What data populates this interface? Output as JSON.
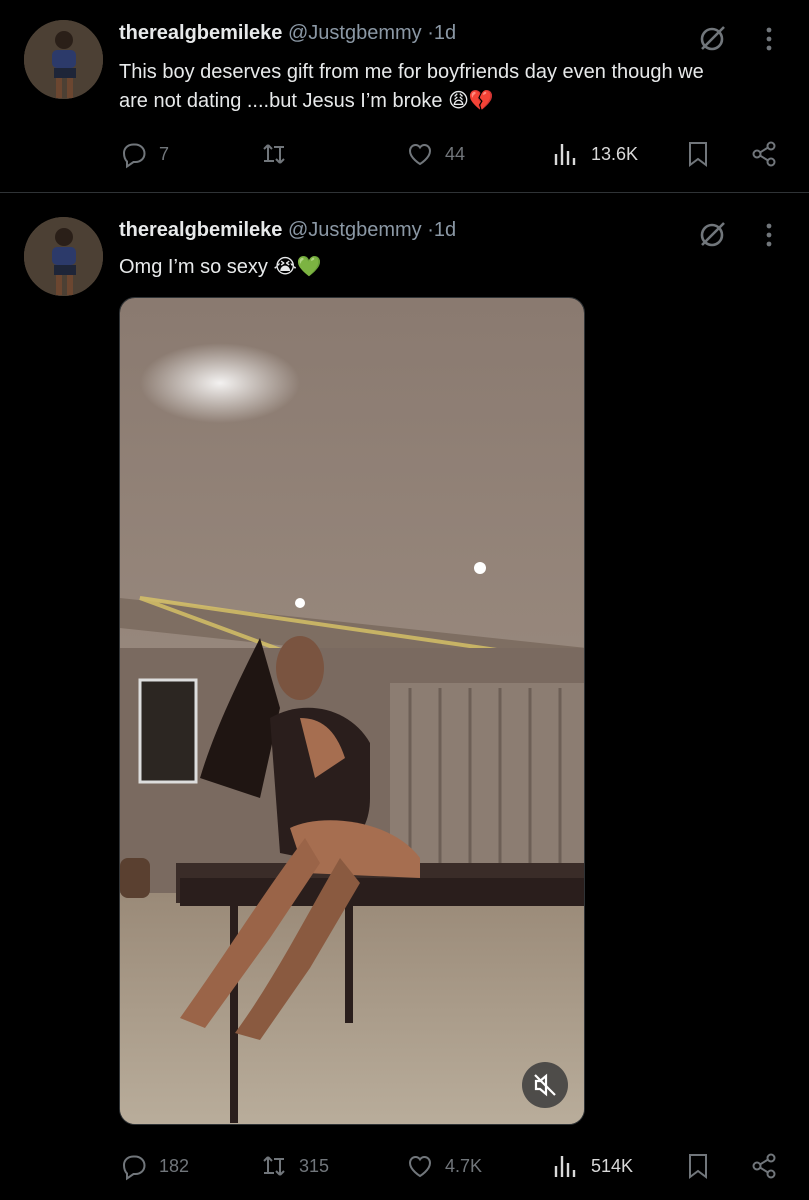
{
  "tweets": [
    {
      "name": "therealgbemileke",
      "handle": "@Justgbemmy",
      "dot": "·",
      "time": "1d",
      "line1": "This boy deserves gift from me for boyfriends day even though we",
      "line2": "are not dating ....but Jesus I’m broke 😩💔",
      "replies": "7",
      "reposts": "",
      "likes": "44",
      "views": "13.6K"
    },
    {
      "name": "therealgbemileke",
      "handle": "@Justgbemmy",
      "dot": "·",
      "time": "1d",
      "line1": "Omg I’m so sexy 😭💚",
      "replies": "182",
      "reposts": "315",
      "likes": "4.7K",
      "views": "514K"
    }
  ],
  "icons": {
    "grok": "grok-icon",
    "more": "more-vertical-icon",
    "reply": "reply-icon",
    "repost": "repost-icon",
    "like": "heart-icon",
    "views": "views-icon",
    "bookmark": "bookmark-icon",
    "share": "share-icon",
    "mute": "muted-speaker-icon"
  },
  "colors": {
    "background": "#000000",
    "text": "#e7e9ea",
    "secondary": "#71767b",
    "divider": "#2f3336"
  }
}
